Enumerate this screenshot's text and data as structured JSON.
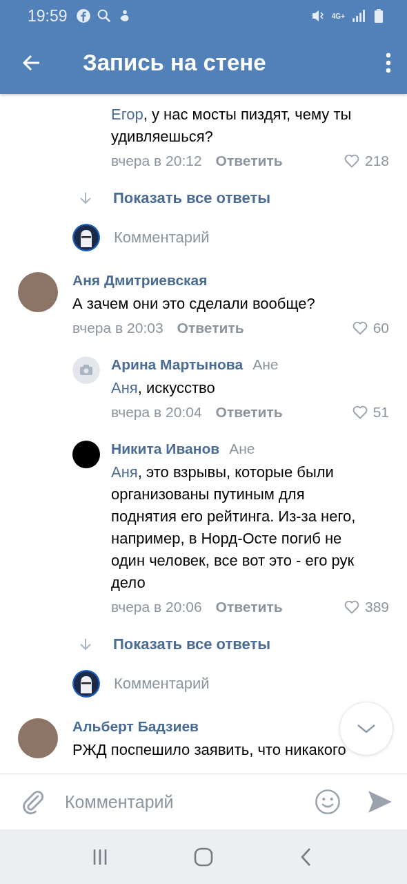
{
  "status_bar": {
    "time": "19:59",
    "network": "4G+"
  },
  "header": {
    "title": "Запись на стене"
  },
  "items": [
    {
      "kind": "reply",
      "mention": "Егор",
      "text": ", у нас мосты пиздят, чему ты удивляешься?",
      "time": "вчера в 20:12",
      "reply_label": "Ответить",
      "likes": "218"
    },
    {
      "kind": "show_replies",
      "label": "Показать все ответы"
    },
    {
      "kind": "comment_input",
      "placeholder": "Комментарий"
    },
    {
      "kind": "comment",
      "avatar": {
        "kind": "photo"
      },
      "author": "Аня Дмитриевская",
      "text": "А зачем они это сделали вообще?",
      "time": "вчера в 20:03",
      "reply_label": "Ответить",
      "likes": "60"
    },
    {
      "kind": "reply",
      "avatar": {
        "kind": "camera"
      },
      "author": "Арина Мартынова",
      "to": "Ане",
      "mention": "Аня",
      "text": ", искусство",
      "time": "вчера в 20:04",
      "reply_label": "Ответить",
      "likes": "51"
    },
    {
      "kind": "reply",
      "avatar": {
        "kind": "dark"
      },
      "author": "Никита Иванов",
      "to": "Ане",
      "mention": "Аня",
      "text": ", это взрывы, которые были организованы путиным для поднятия его рейтинга. Из-за него, например, в Норд-Осте погиб не один человек, все вот это - его рук дело",
      "time": "вчера в 20:06",
      "reply_label": "Ответить",
      "likes": "389"
    },
    {
      "kind": "show_replies",
      "label": "Показать все ответы"
    },
    {
      "kind": "comment_input",
      "placeholder": "Комментарий"
    },
    {
      "kind": "comment",
      "avatar": {
        "kind": "photo"
      },
      "author": "Альберт Бадзиев",
      "text": "РЖД поспешило заявить, что никакого"
    }
  ],
  "composer": {
    "placeholder": "Комментарий"
  }
}
